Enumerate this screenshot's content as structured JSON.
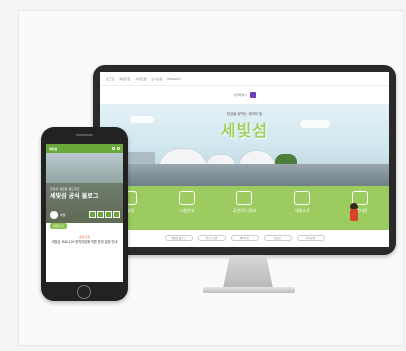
{
  "desktop": {
    "topnav": [
      "로그인",
      "회원가입",
      "사이트맵",
      "오시는길",
      "ENGLISH"
    ],
    "logo_text": "서울특별시",
    "hero_subtitle": "한강을 밝히는 세개의 빛",
    "hero_title": "세빛섬",
    "menu": [
      {
        "label": "세빛섬",
        "icon": "building-icon"
      },
      {
        "label": "시설안내",
        "icon": "search-doc-icon"
      },
      {
        "label": "공연/전시정보",
        "icon": "document-icon"
      },
      {
        "label": "새빛소식",
        "icon": "mail-icon"
      },
      {
        "label": "이용대관",
        "icon": "chat-icon"
      }
    ],
    "sns": [
      "세빛섬 블로그",
      "인스타그램",
      "페이스북",
      "유튜브",
      "카카오톡"
    ]
  },
  "mobile": {
    "logo": "세빛섬",
    "caption": "한강의 새로운 랜드마크",
    "title": "세빛섬 공식 블로그",
    "badge_text": "세빛",
    "button_label": "바로가기",
    "notice_head": "공지사항",
    "notice_text": "세빛섬 코로나19 방역지침에 따른 운영 일정 안내"
  },
  "colors": {
    "brand_green": "#9ccc5f",
    "phone_green": "#6aa839",
    "bezel": "#2a2a2a"
  }
}
